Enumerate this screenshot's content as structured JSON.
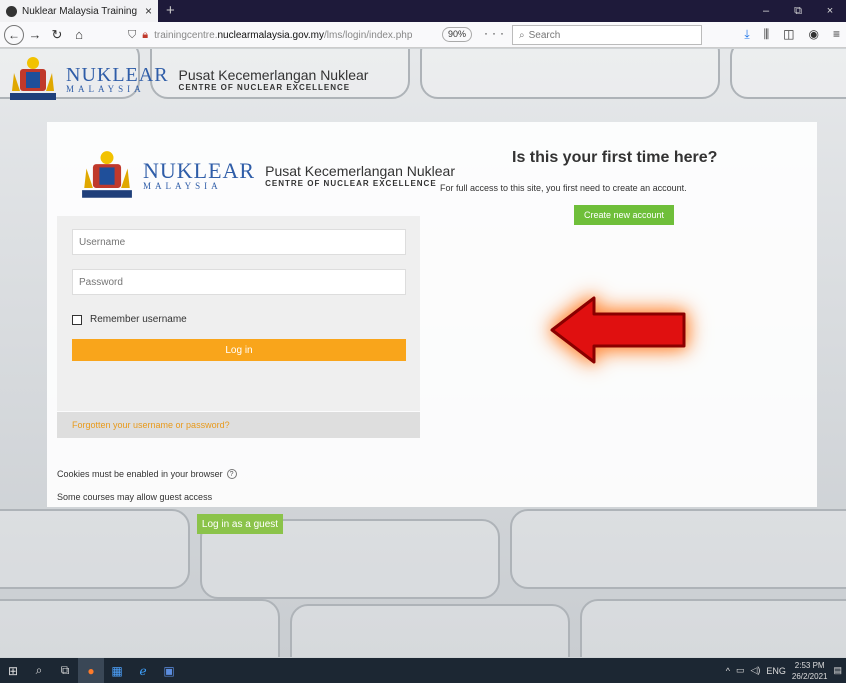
{
  "browser": {
    "tab_title": "Nuklear Malaysia Training Cent",
    "tab_close": "×",
    "new_tab": "+",
    "url_plain": "trainingcentre.",
    "url_domain": "nuclearmalaysia.gov.my",
    "url_path": "/lms/login/index.php",
    "zoom": "90%",
    "page_actions": "··· ⛉ ☆",
    "search_placeholder": "Search",
    "win_min": "–",
    "win_max": "⧉",
    "win_close": "×"
  },
  "site_header": {
    "logo_nuklear": "NUKLEAR",
    "logo_malaysia": "MALAYSIA",
    "pusat": "Pusat Kecemerlangan Nuklear",
    "centre": "CENTRE OF NUCLEAR EXCELLENCE"
  },
  "login": {
    "username_placeholder": "Username",
    "password_placeholder": "Password",
    "remember_label": "Remember username",
    "login_button": "Log in",
    "forgot_link": "Forgotten your username or password?",
    "cookies_note": "Cookies must be enabled in your browser",
    "cookies_help": "?",
    "guest_note": "Some courses may allow guest access",
    "guest_button": "Log in as a guest"
  },
  "signup": {
    "heading": "Is this your first time here?",
    "text": "For full access to this site, you first need to create an account.",
    "create_button": "Create new account"
  },
  "taskbar": {
    "lang": "ENG",
    "time": "2:53 PM",
    "date": "26/2/2021"
  },
  "colors": {
    "login_orange": "#f9a51b",
    "guest_green": "#8bc34a",
    "create_green": "#6fbf3a",
    "arrow_red": "#e01010",
    "logo_blue": "#2f5da8"
  }
}
